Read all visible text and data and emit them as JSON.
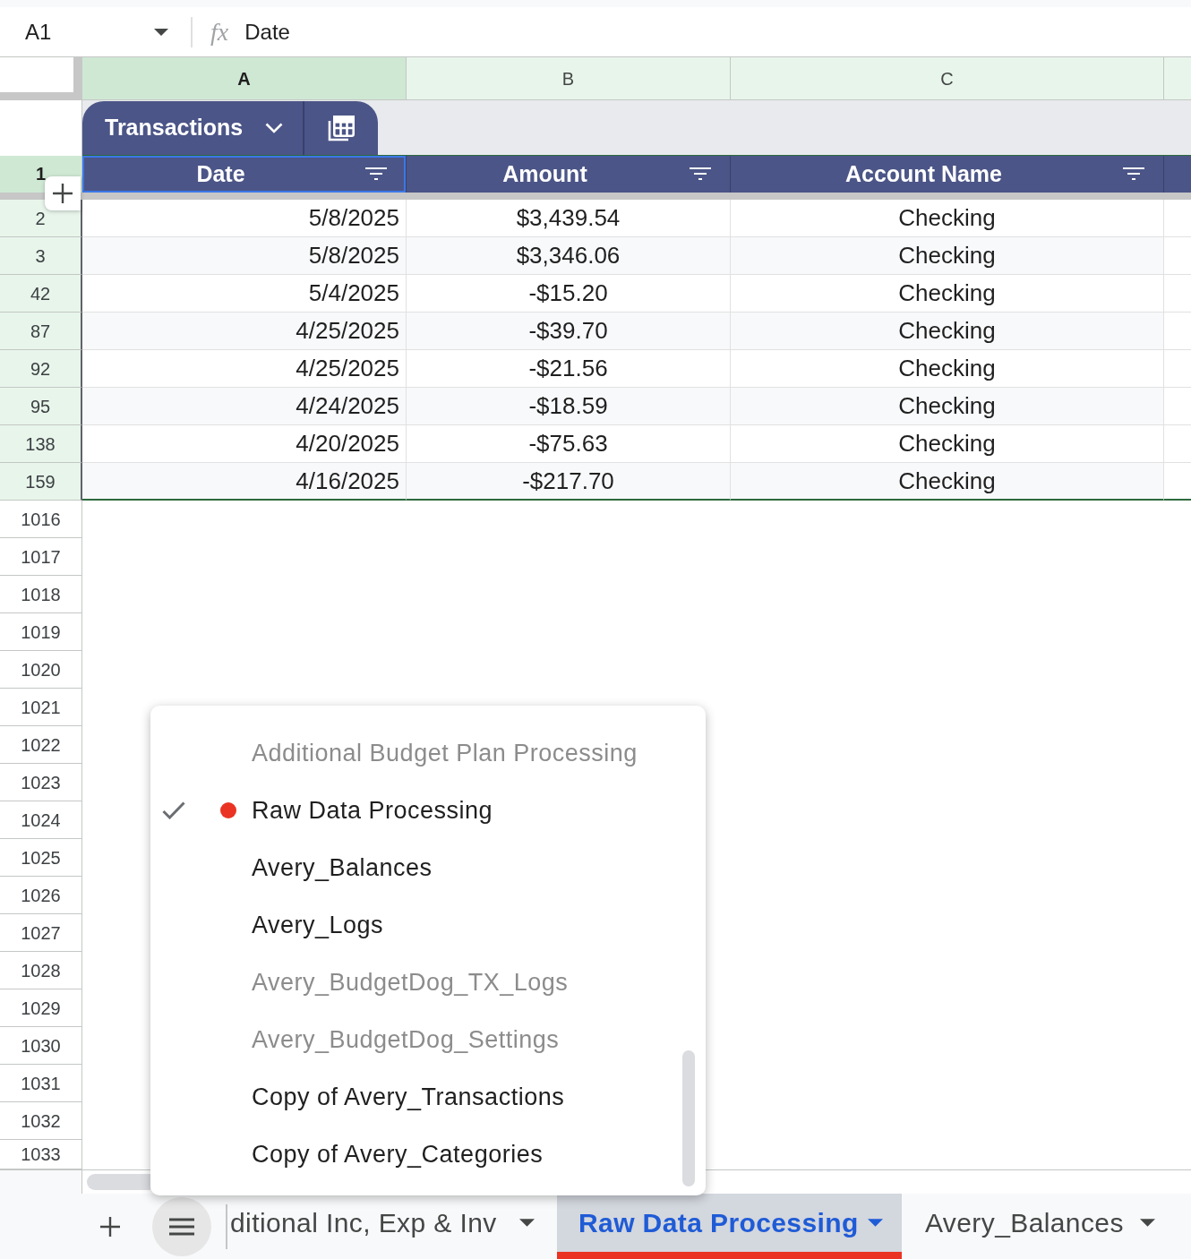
{
  "formula_bar": {
    "cell_ref": "A1",
    "function_label": "fx",
    "value": "Date"
  },
  "columns": [
    {
      "label": "A",
      "selected": true
    },
    {
      "label": "B",
      "selected": false
    },
    {
      "label": "C",
      "selected": false
    }
  ],
  "table": {
    "name": "Transactions",
    "header_row": {
      "row_number": "1",
      "selected": true
    },
    "headers": [
      {
        "label": "Date",
        "selected": true
      },
      {
        "label": "Amount",
        "selected": false
      },
      {
        "label": "Account Name",
        "selected": false
      }
    ],
    "rows": [
      {
        "row_number": "2",
        "cells": [
          "5/8/2025",
          "$3,439.54",
          "Checking"
        ]
      },
      {
        "row_number": "3",
        "cells": [
          "5/8/2025",
          "$3,346.06",
          "Checking"
        ]
      },
      {
        "row_number": "42",
        "cells": [
          "5/4/2025",
          "-$15.20",
          "Checking"
        ]
      },
      {
        "row_number": "87",
        "cells": [
          "4/25/2025",
          "-$39.70",
          "Checking"
        ]
      },
      {
        "row_number": "92",
        "cells": [
          "4/25/2025",
          "-$21.56",
          "Checking"
        ]
      },
      {
        "row_number": "95",
        "cells": [
          "4/24/2025",
          "-$18.59",
          "Checking"
        ]
      },
      {
        "row_number": "138",
        "cells": [
          "4/20/2025",
          "-$75.63",
          "Checking"
        ]
      },
      {
        "row_number": "159",
        "cells": [
          "4/16/2025",
          "-$217.70",
          "Checking"
        ]
      }
    ]
  },
  "empty_rows": [
    "1016",
    "1017",
    "1018",
    "1019",
    "1020",
    "1021",
    "1022",
    "1023",
    "1024",
    "1025",
    "1026",
    "1027",
    "1028",
    "1029",
    "1030",
    "1031",
    "1032",
    "1033"
  ],
  "sheet_menu": {
    "items": [
      {
        "label": "Additional Budget Plan Processing",
        "hidden": true,
        "selected": false
      },
      {
        "label": "Raw Data Processing",
        "hidden": false,
        "selected": true,
        "color": "#ea3323"
      },
      {
        "label": "Avery_Balances",
        "hidden": false,
        "selected": false
      },
      {
        "label": "Avery_Logs",
        "hidden": false,
        "selected": false
      },
      {
        "label": "Avery_BudgetDog_TX_Logs",
        "hidden": true,
        "selected": false
      },
      {
        "label": "Avery_BudgetDog_Settings",
        "hidden": true,
        "selected": false
      },
      {
        "label": "Copy of Avery_Transactions",
        "hidden": false,
        "selected": false
      },
      {
        "label": "Copy of Avery_Categories",
        "hidden": false,
        "selected": false
      }
    ]
  },
  "sheet_tabs": [
    {
      "label": "ditional Inc, Exp & Inv",
      "selected": false
    },
    {
      "label": "Raw Data Processing",
      "selected": true,
      "color": "#ea3323"
    },
    {
      "label": "Avery_Balances",
      "selected": false
    }
  ]
}
